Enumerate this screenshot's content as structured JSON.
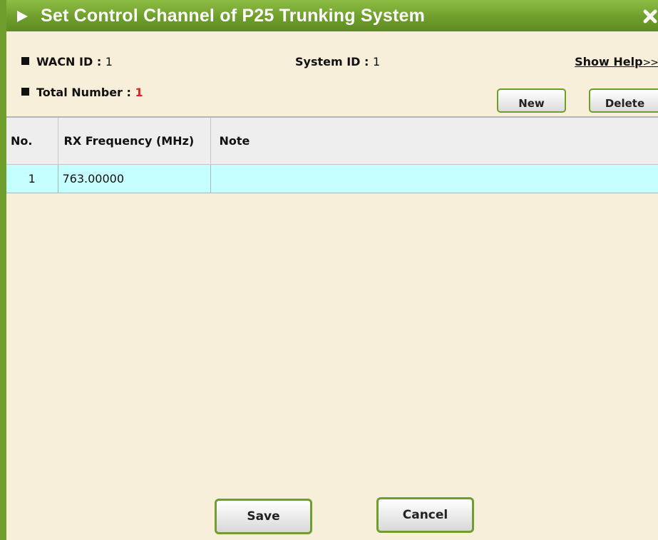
{
  "dialog": {
    "title": "Set Control Channel of P25 Trunking System",
    "close_symbol": "x"
  },
  "info": {
    "wacn_label": "WACN ID : ",
    "wacn_value": "1",
    "system_label": "System ID : ",
    "system_value": "1",
    "total_label": "Total Number : ",
    "total_value": "1",
    "help_label": "Show Help",
    "help_arrows": ">>"
  },
  "toolbar": {
    "new_label": "New",
    "delete_label": "Delete"
  },
  "table": {
    "columns": [
      "No.",
      "RX Frequency (MHz)",
      "Note"
    ],
    "rows": [
      {
        "no": "1",
        "rx_frequency": "763.00000",
        "note": ""
      }
    ]
  },
  "footer": {
    "save_label": "Save",
    "cancel_label": "Cancel"
  },
  "colors": {
    "accent_green": "#6f9e2c",
    "panel_bg": "#f7efda",
    "row_highlight": "#c6ffff",
    "total_value_red": "#e02020"
  }
}
